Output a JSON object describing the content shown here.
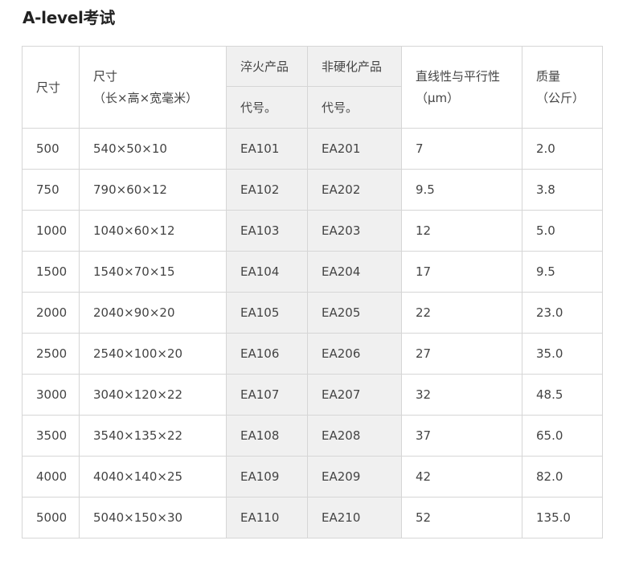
{
  "page": {
    "title": "A-level考试"
  },
  "table": {
    "headers": {
      "size": "尺寸",
      "dimensions": {
        "line1": "尺寸",
        "line2": "（长×高×宽毫米）"
      },
      "quenched": {
        "group": "淬火产品",
        "code": "代号。"
      },
      "non_hardened": {
        "group": "非硬化产品",
        "code": "代号。"
      },
      "straightness": {
        "line1": "直线性与平行性",
        "line2": "（μm）"
      },
      "mass": {
        "line1": "质量",
        "line2": "（公斤）"
      }
    },
    "rows": [
      {
        "size": "500",
        "dimensions": "540×50×10",
        "quenched_code": "EA101",
        "non_hardened_code": "EA201",
        "straightness": "7",
        "mass": "2.0"
      },
      {
        "size": "750",
        "dimensions": "790×60×12",
        "quenched_code": "EA102",
        "non_hardened_code": "EA202",
        "straightness": "9.5",
        "mass": "3.8"
      },
      {
        "size": "1000",
        "dimensions": "1040×60×12",
        "quenched_code": "EA103",
        "non_hardened_code": "EA203",
        "straightness": "12",
        "mass": "5.0"
      },
      {
        "size": "1500",
        "dimensions": "1540×70×15",
        "quenched_code": "EA104",
        "non_hardened_code": "EA204",
        "straightness": "17",
        "mass": "9.5"
      },
      {
        "size": "2000",
        "dimensions": "2040×90×20",
        "quenched_code": "EA105",
        "non_hardened_code": "EA205",
        "straightness": "22",
        "mass": "23.0"
      },
      {
        "size": "2500",
        "dimensions": "2540×100×20",
        "quenched_code": "EA106",
        "non_hardened_code": "EA206",
        "straightness": "27",
        "mass": "35.0"
      },
      {
        "size": "3000",
        "dimensions": "3040×120×22",
        "quenched_code": "EA107",
        "non_hardened_code": "EA207",
        "straightness": "32",
        "mass": "48.5"
      },
      {
        "size": "3500",
        "dimensions": "3540×135×22",
        "quenched_code": "EA108",
        "non_hardened_code": "EA208",
        "straightness": "37",
        "mass": "65.0"
      },
      {
        "size": "4000",
        "dimensions": "4040×140×25",
        "quenched_code": "EA109",
        "non_hardened_code": "EA209",
        "straightness": "42",
        "mass": "82.0"
      },
      {
        "size": "5000",
        "dimensions": "5040×150×30",
        "quenched_code": "EA110",
        "non_hardened_code": "EA210",
        "straightness": "52",
        "mass": "135.0"
      }
    ]
  },
  "colors": {
    "border": "#d6d6d6",
    "shaded_column_bg": "#f0f0f0",
    "text": "#444444",
    "title": "#222222"
  }
}
